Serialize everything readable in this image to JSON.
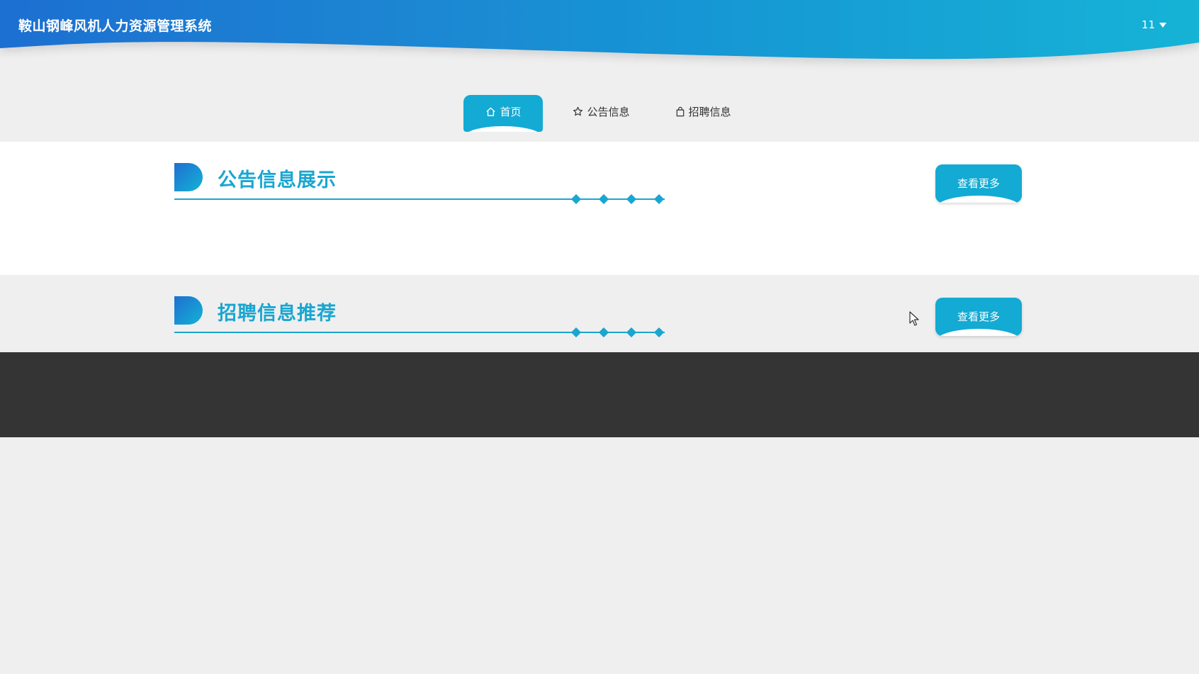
{
  "header": {
    "title": "鞍山钢峰风机人力资源管理系统",
    "user": "11",
    "gradient_start": "#1f6fd1",
    "gradient_end": "#13b3d6"
  },
  "nav": {
    "items": [
      {
        "label": "首页",
        "icon": "home-icon",
        "active": true
      },
      {
        "label": "公告信息",
        "icon": "star-icon",
        "active": false
      },
      {
        "label": "招聘信息",
        "icon": "bag-icon",
        "active": false
      }
    ]
  },
  "sections": [
    {
      "title": "公告信息展示",
      "more_label": "查看更多"
    },
    {
      "title": "招聘信息推荐",
      "more_label": "查看更多"
    }
  ],
  "colors": {
    "accent": "#13aad3",
    "title_blue": "#19a6d0",
    "footer": "#343434",
    "background": "#efefef"
  }
}
